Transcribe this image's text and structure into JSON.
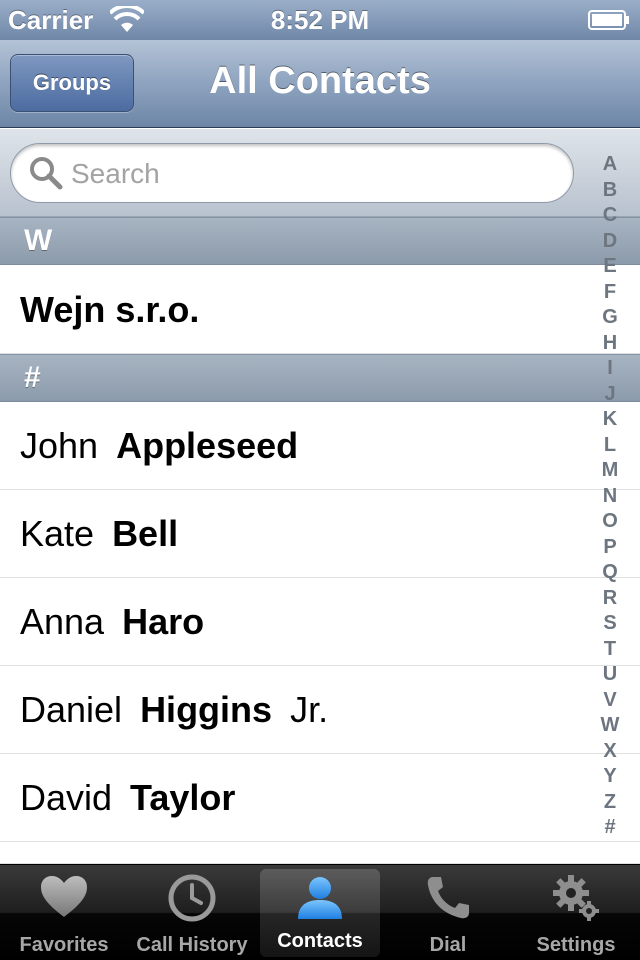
{
  "status_bar": {
    "carrier": "Carrier",
    "time": "8:52 PM"
  },
  "nav_bar": {
    "groups_button": "Groups",
    "title": "All Contacts"
  },
  "search": {
    "placeholder": "Search"
  },
  "sections": [
    {
      "header": "W",
      "rows": [
        {
          "first": "",
          "last": "Wejn s.r.o.",
          "suffix": ""
        }
      ]
    },
    {
      "header": "#",
      "rows": [
        {
          "first": "John",
          "last": "Appleseed",
          "suffix": ""
        },
        {
          "first": "Kate",
          "last": "Bell",
          "suffix": ""
        },
        {
          "first": "Anna",
          "last": "Haro",
          "suffix": ""
        },
        {
          "first": "Daniel",
          "last": "Higgins",
          "suffix": "Jr."
        },
        {
          "first": "David",
          "last": "Taylor",
          "suffix": ""
        }
      ]
    }
  ],
  "index_letters": [
    "A",
    "B",
    "C",
    "D",
    "E",
    "F",
    "G",
    "H",
    "I",
    "J",
    "K",
    "L",
    "M",
    "N",
    "O",
    "P",
    "Q",
    "R",
    "S",
    "T",
    "U",
    "V",
    "W",
    "X",
    "Y",
    "Z",
    "#"
  ],
  "tab_bar": {
    "tabs": [
      {
        "label": "Favorites",
        "icon": "heart-icon"
      },
      {
        "label": "Call History",
        "icon": "clock-icon"
      },
      {
        "label": "Contacts",
        "icon": "person-icon"
      },
      {
        "label": "Dial",
        "icon": "phone-icon"
      },
      {
        "label": "Settings",
        "icon": "gear-icon"
      }
    ],
    "selected": "Contacts"
  },
  "colors": {
    "selected_tab_icon": "#3aa0f0"
  }
}
